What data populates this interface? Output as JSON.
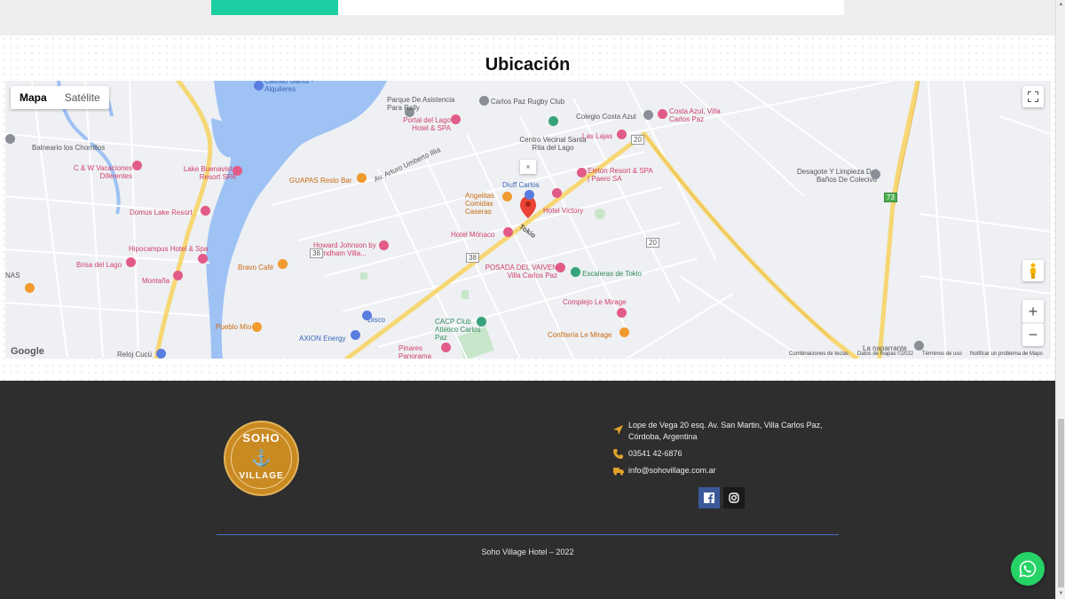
{
  "section": {
    "title": "Ubicación"
  },
  "map": {
    "type_buttons": [
      "Mapa",
      "Satélite"
    ],
    "active_type": "Mapa",
    "zoom_in": "+",
    "zoom_out": "−",
    "popup_close": "×",
    "google_logo": "Google",
    "attribution": [
      "Combinaciones de teclas",
      "Datos de mapas ©2022",
      "Términos de uso",
      "Notificar un problema de Maps"
    ],
    "places": {
      "castillo": "Castillo Ganot - Alquileres",
      "parque": "Parque De Asistencia Para Rally",
      "rugby": "Carlos Paz Rugby Club",
      "portal": "Portal del Lago Hotel & SPA",
      "centro": "Centro Vecinal Santa Rita del Lago",
      "colegio": "Colegio Costa Azul",
      "costa_azul": "Costa Azul, Villa Carlos Paz",
      "lajas": "Las Lajas",
      "balneario": "Balneario los Chorrillos",
      "cw": "C & W Vacaciones Diferentes",
      "lake_buena": "Lake Buenavista Resort SPA",
      "guapas": "GUAPAS Resto Bar",
      "diuff": "Diuff Carlos",
      "eleton": "Eleton Resort & SPA | Paero SA",
      "desagote": "Desagote Y Limpieza Del Baños De Colecivo",
      "angelitas": "Angelitas Comidas Caseras",
      "victory": "Hotel Victory",
      "domus": "Domus Lake Resort",
      "monaco": "Hotel Mónaco",
      "howard": "Howard Johnson by Wyndham Villa...",
      "hipocampus": "Hipocampus Hotel & Spa",
      "brisa": "Brisa del Lago",
      "bravo": "Bravo Café",
      "posada": "POSADA DEL VAIVEN Villa Carlos Paz",
      "escaleras": "Escaleras de Tokio",
      "montana": "Montaña",
      "complejo": "Complejo Le Mirage",
      "cacp": "CACP Club Atlético Carlos Paz",
      "disco": "Disco",
      "pueblo": "Pueblo Mío",
      "axion": "AXION Energy",
      "pinares": "Pinares Panorama Suites SPA &",
      "confiteria": "Confitería Le Mirage",
      "reloj": "Reloj Cucú",
      "naparrante": "La naparrante",
      "nas": "NAS"
    },
    "streets": {
      "umberto": "Av. Arturo Umberto Illia",
      "tokio": "Tokio",
      "r20a": "20",
      "r20b": "20",
      "r38a": "38",
      "r38b": "38",
      "r73": "73"
    }
  },
  "footer": {
    "logo_top": "SOHO",
    "logo_bottom": "VILLAGE",
    "address": "Lope de Vega 20 esq. Av. San Martin, Villa Carlos Paz, Córdoba, Argentina",
    "phone": "03541 42-6876",
    "email": "info@sohovillage.com.ar",
    "social": [
      "facebook",
      "instagram"
    ],
    "copyright": "Soho Village Hotel – 2022"
  },
  "colors": {
    "accent_teal": "#1ccfa3",
    "footer_bg": "#2e2e2e",
    "icon_gold": "#e0a12d",
    "divider_blue": "#4a70c9",
    "whatsapp_green": "#25d366"
  },
  "icons": {
    "address": "location-arrow-icon",
    "phone": "phone-icon",
    "email": "truck-mail-icon",
    "facebook": "facebook-icon",
    "instagram": "instagram-icon",
    "whatsapp": "whatsapp-icon",
    "fullscreen": "fullscreen-icon",
    "pegman": "pegman-icon",
    "pin": "map-pin-icon"
  }
}
